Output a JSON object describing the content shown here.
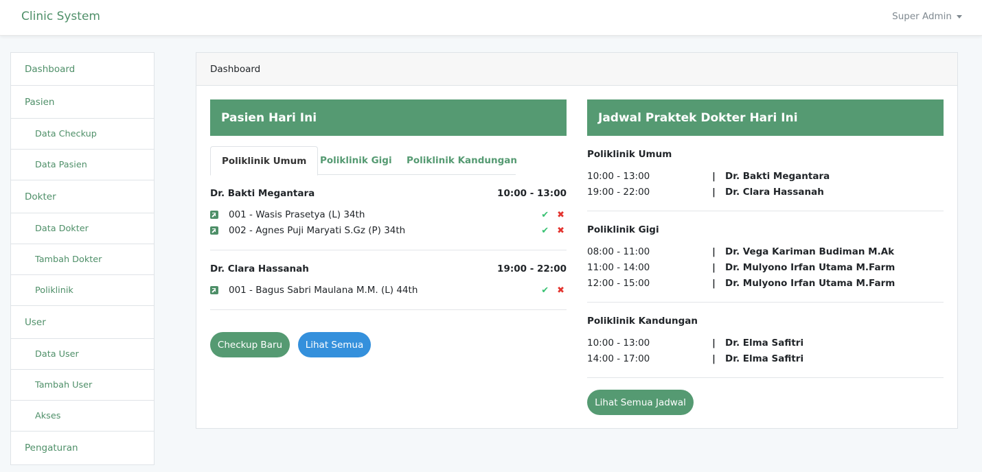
{
  "navbar": {
    "brand": "Clinic System",
    "user": "Super Admin"
  },
  "sidebar": {
    "items": [
      {
        "label": "Dashboard",
        "level": "main"
      },
      {
        "label": "Pasien",
        "level": "main"
      },
      {
        "label": "Data Checkup",
        "level": "sub"
      },
      {
        "label": "Data Pasien",
        "level": "sub"
      },
      {
        "label": "Dokter",
        "level": "main"
      },
      {
        "label": "Data Dokter",
        "level": "sub"
      },
      {
        "label": "Tambah Dokter",
        "level": "sub"
      },
      {
        "label": "Poliklinik",
        "level": "sub"
      },
      {
        "label": "User",
        "level": "main"
      },
      {
        "label": "Data User",
        "level": "sub"
      },
      {
        "label": "Tambah User",
        "level": "sub"
      },
      {
        "label": "Akses",
        "level": "sub"
      },
      {
        "label": "Pengaturan",
        "level": "main"
      }
    ]
  },
  "card": {
    "header": "Dashboard"
  },
  "patients_panel": {
    "title": "Pasien Hari Ini",
    "tabs": [
      {
        "label": "Poliklinik Umum",
        "active": true
      },
      {
        "label": "Poliklinik Gigi",
        "active": false
      },
      {
        "label": "Poliklinik Kandungan",
        "active": false
      }
    ],
    "groups": [
      {
        "doctor": "Dr. Bakti Megantara",
        "time": "10:00 - 13:00",
        "patients": [
          "001 - Wasis Prasetya (L) 34th",
          "002 - Agnes Puji Maryati S.Gz (P) 34th"
        ]
      },
      {
        "doctor": "Dr. Clara Hassanah",
        "time": "19:00 - 22:00",
        "patients": [
          "001 - Bagus Sabri Maulana M.M. (L) 44th"
        ]
      }
    ],
    "buttons": {
      "new_checkup": "Checkup Baru",
      "see_all": "Lihat Semua"
    },
    "icons": {
      "patient": "external-link-icon",
      "approve": "check-icon",
      "reject": "close-icon"
    }
  },
  "schedule_panel": {
    "title": "Jadwal Praktek Dokter Hari Ini",
    "sections": [
      {
        "name": "Poliklinik Umum",
        "rows": [
          {
            "time": "10:00 - 13:00",
            "sep": "|",
            "doctor": "Dr. Bakti Megantara"
          },
          {
            "time": "19:00 - 22:00",
            "sep": "|",
            "doctor": "Dr. Clara Hassanah"
          }
        ]
      },
      {
        "name": "Poliklinik Gigi",
        "rows": [
          {
            "time": "08:00 - 11:00",
            "sep": "|",
            "doctor": "Dr. Vega Kariman Budiman M.Ak"
          },
          {
            "time": "11:00 - 14:00",
            "sep": "|",
            "doctor": "Dr. Mulyono Irfan Utama M.Farm"
          },
          {
            "time": "12:00 - 15:00",
            "sep": "|",
            "doctor": "Dr. Mulyono Irfan Utama M.Farm"
          }
        ]
      },
      {
        "name": "Poliklinik Kandungan",
        "rows": [
          {
            "time": "10:00 - 13:00",
            "sep": "|",
            "doctor": "Dr. Elma Safitri"
          },
          {
            "time": "14:00 - 17:00",
            "sep": "|",
            "doctor": "Dr. Elma Safitri"
          }
        ]
      }
    ],
    "button": "Lihat Semua Jadwal"
  },
  "colors": {
    "primary": "#559a72",
    "brand": "#4e8f68",
    "info": "#3490dc",
    "success": "#38c172",
    "danger": "#e3342f"
  }
}
